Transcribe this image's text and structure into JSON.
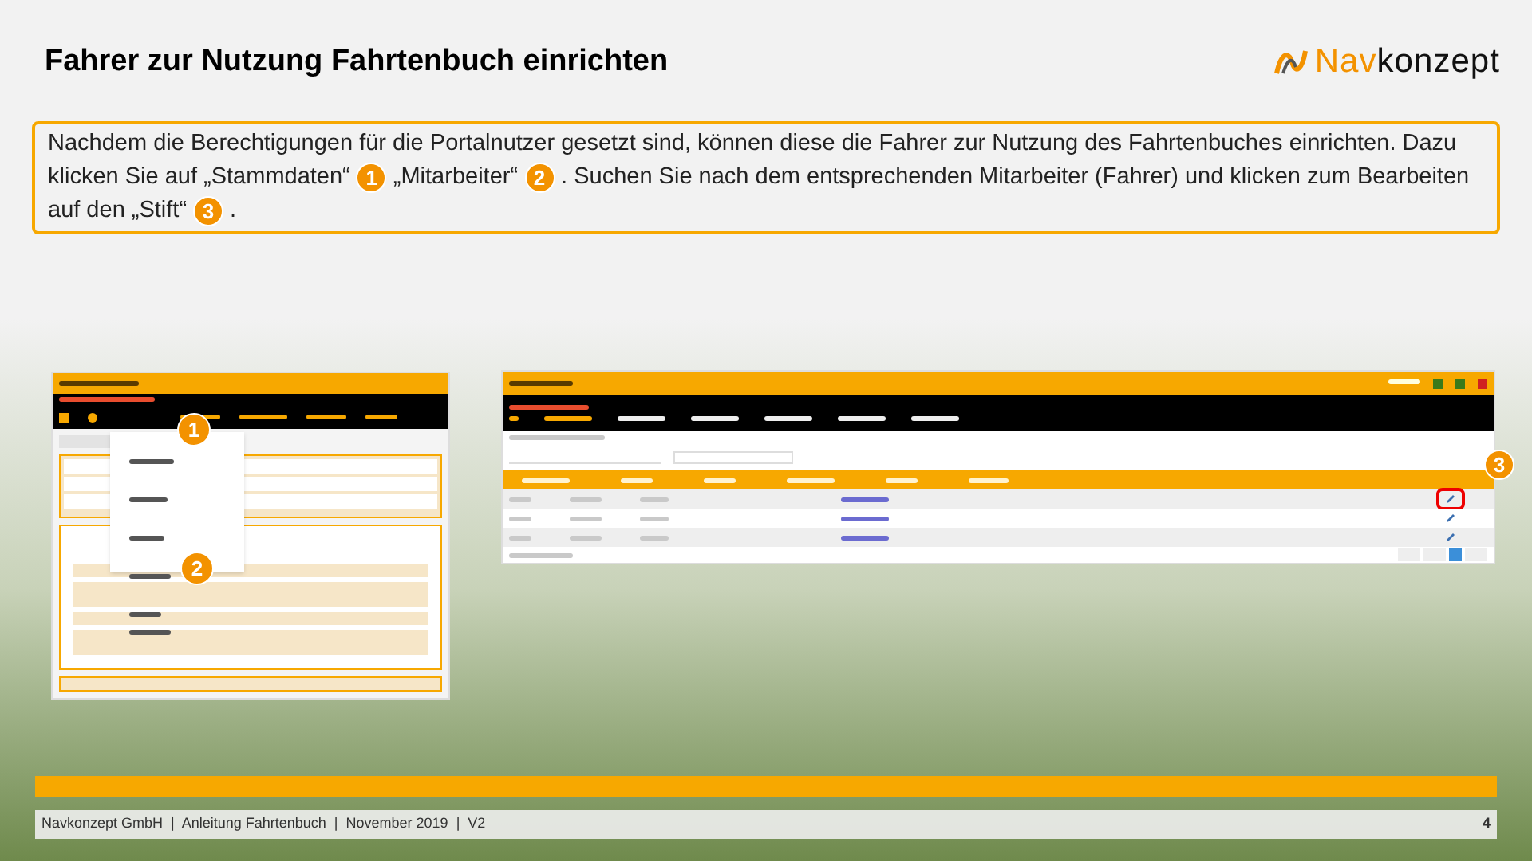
{
  "title": "Fahrer zur Nutzung Fahrtenbuch einrichten",
  "logo": {
    "part_1": "Nav",
    "part_2": "konzept"
  },
  "instruction": [
    {
      "kind": "text",
      "text": "Nachdem die Berechtigungen für die Portalnutzer gesetzt sind, können diese die Fahrer zur Nutzung des Fahrtenbuches einrichten. Dazu klicken Sie auf „Stammdaten“"
    },
    {
      "kind": "badge",
      "text": "1"
    },
    {
      "kind": "text",
      "text": "„Mitarbeiter“"
    },
    {
      "kind": "badge",
      "text": "2"
    },
    {
      "kind": "text",
      "text": ". Suchen Sie nach dem entsprechenden Mitarbeiter (Fahrer) und klicken zum Bearbeiten auf den „Stift“"
    },
    {
      "kind": "badge",
      "text": "3"
    },
    {
      "kind": "text",
      "text": "."
    }
  ],
  "screenshots": [
    {
      "markers": [
        "1",
        "2"
      ]
    },
    {
      "markers": [
        "3"
      ]
    }
  ],
  "footer": {
    "text": "Navkonzept GmbH  |  Anleitung Fahrtenbuch  |  November 2019  |  V2",
    "page": "4"
  }
}
